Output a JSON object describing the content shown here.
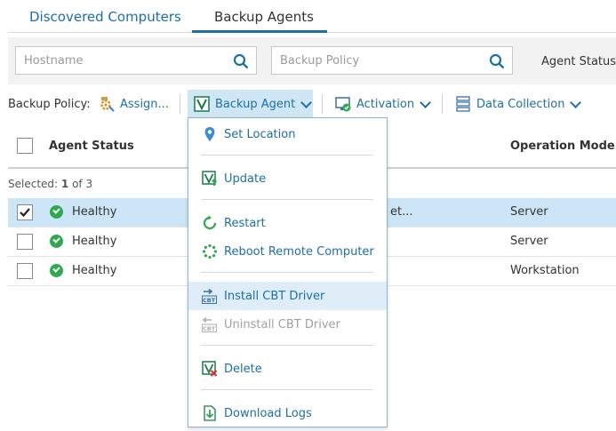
{
  "tabs": [
    {
      "label": "Discovered Computers",
      "active": false
    },
    {
      "label": "Backup Agents",
      "active": true
    }
  ],
  "filters": {
    "hostname_placeholder": "Hostname",
    "policy_placeholder": "Backup Policy",
    "agent_status_label": "Agent Status:"
  },
  "toolbar": {
    "policy_label": "Backup Policy:",
    "assign_label": "Assign...",
    "backup_agent_label": "Backup Agent",
    "activation_label": "Activation",
    "data_collection_label": "Data Collection"
  },
  "table": {
    "headers": {
      "agent_status": "Agent Status",
      "operation_mode": "Operation Mode"
    },
    "selected_prefix": "Selected:",
    "selected_count": "1",
    "selected_suffix": "of 3",
    "rows": [
      {
        "status": "Healthy",
        "partial": "et...",
        "mode": "Server",
        "selected": true
      },
      {
        "status": "Healthy",
        "partial": "",
        "mode": "Server",
        "selected": false
      },
      {
        "status": "Healthy",
        "partial": "",
        "mode": "Workstation",
        "selected": false
      }
    ]
  },
  "menu": {
    "items": [
      {
        "label": "Set Location",
        "icon": "location-pin-icon",
        "enabled": true
      },
      {
        "label": "Update",
        "icon": "agent-update-icon",
        "enabled": true
      },
      {
        "label": "Restart",
        "icon": "restart-icon",
        "enabled": true
      },
      {
        "label": "Reboot Remote Computer",
        "icon": "reboot-spinner-icon",
        "enabled": true
      },
      {
        "label": "Install CBT Driver",
        "icon": "cbt-install-icon",
        "enabled": true
      },
      {
        "label": "Uninstall CBT Driver",
        "icon": "cbt-uninstall-icon",
        "enabled": false
      },
      {
        "label": "Delete",
        "icon": "agent-delete-icon",
        "enabled": true
      },
      {
        "label": "Download Logs",
        "icon": "download-logs-icon",
        "enabled": true
      }
    ]
  },
  "colors": {
    "accent": "#1d6fa5",
    "selected_row": "#cde6f7",
    "healthy": "#2fa84f"
  }
}
